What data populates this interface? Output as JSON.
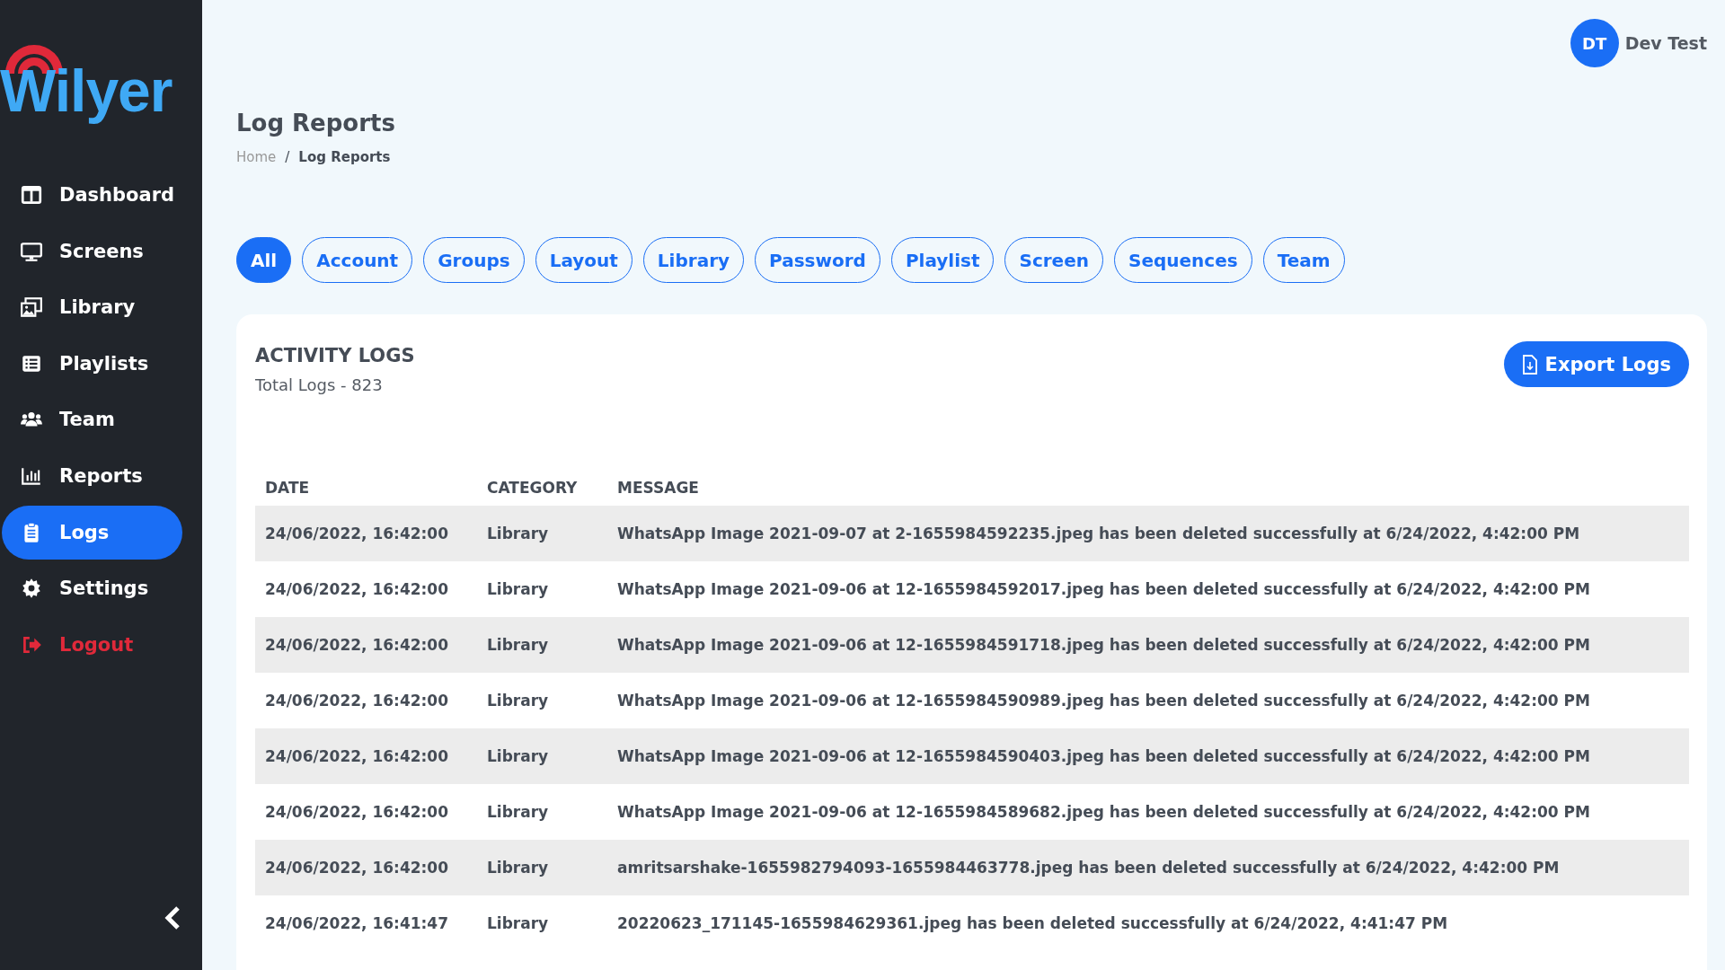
{
  "logo": {
    "text": "Wilyer"
  },
  "sidebar": {
    "items": [
      {
        "label": "Dashboard",
        "selected": false,
        "kind": "nav"
      },
      {
        "label": "Screens",
        "selected": false,
        "kind": "nav"
      },
      {
        "label": "Library",
        "selected": false,
        "kind": "nav"
      },
      {
        "label": "Playlists",
        "selected": false,
        "kind": "nav"
      },
      {
        "label": "Team",
        "selected": false,
        "kind": "nav"
      },
      {
        "label": "Reports",
        "selected": false,
        "kind": "nav"
      },
      {
        "label": "Logs",
        "selected": true,
        "kind": "nav"
      },
      {
        "label": "Settings",
        "selected": false,
        "kind": "nav"
      },
      {
        "label": "Logout",
        "selected": false,
        "kind": "danger"
      }
    ]
  },
  "user": {
    "initials": "DT",
    "name": "Dev Test"
  },
  "page_title": "Log Reports",
  "breadcrumb_separator": "/",
  "breadcrumb": [
    {
      "label": "Home",
      "current": false
    },
    {
      "label": "Log Reports",
      "current": true
    }
  ],
  "filters": [
    {
      "label": "All",
      "selected": true
    },
    {
      "label": "Account",
      "selected": false
    },
    {
      "label": "Groups",
      "selected": false
    },
    {
      "label": "Layout",
      "selected": false
    },
    {
      "label": "Library",
      "selected": false
    },
    {
      "label": "Password",
      "selected": false
    },
    {
      "label": "Playlist",
      "selected": false
    },
    {
      "label": "Screen",
      "selected": false
    },
    {
      "label": "Sequences",
      "selected": false
    },
    {
      "label": "Team",
      "selected": false
    }
  ],
  "card": {
    "title": "ACTIVITY LOGS",
    "subtitle": "Total Logs - 823",
    "export_button": "Export Logs"
  },
  "table": {
    "columns": [
      "DATE",
      "CATEGORY",
      "MESSAGE"
    ],
    "rows": [
      [
        "24/06/2022, 16:42:00",
        "Library",
        "WhatsApp Image 2021-09-07 at 2-1655984592235.jpeg has been deleted successfully at 6/24/2022, 4:42:00 PM"
      ],
      [
        "24/06/2022, 16:42:00",
        "Library",
        "WhatsApp Image 2021-09-06 at 12-1655984592017.jpeg has been deleted successfully at 6/24/2022, 4:42:00 PM"
      ],
      [
        "24/06/2022, 16:42:00",
        "Library",
        "WhatsApp Image 2021-09-06 at 12-1655984591718.jpeg has been deleted successfully at 6/24/2022, 4:42:00 PM"
      ],
      [
        "24/06/2022, 16:42:00",
        "Library",
        "WhatsApp Image 2021-09-06 at 12-1655984590989.jpeg has been deleted successfully at 6/24/2022, 4:42:00 PM"
      ],
      [
        "24/06/2022, 16:42:00",
        "Library",
        "WhatsApp Image 2021-09-06 at 12-1655984590403.jpeg has been deleted successfully at 6/24/2022, 4:42:00 PM"
      ],
      [
        "24/06/2022, 16:42:00",
        "Library",
        "WhatsApp Image 2021-09-06 at 12-1655984589682.jpeg has been deleted successfully at 6/24/2022, 4:42:00 PM"
      ],
      [
        "24/06/2022, 16:42:00",
        "Library",
        "amritsarshake-1655982794093-1655984463778.jpeg has been deleted successfully at 6/24/2022, 4:42:00 PM"
      ],
      [
        "24/06/2022, 16:41:47",
        "Library",
        "20220623_171145-1655984629361.jpeg has been deleted successfully at 6/24/2022, 4:41:47 PM"
      ]
    ]
  }
}
